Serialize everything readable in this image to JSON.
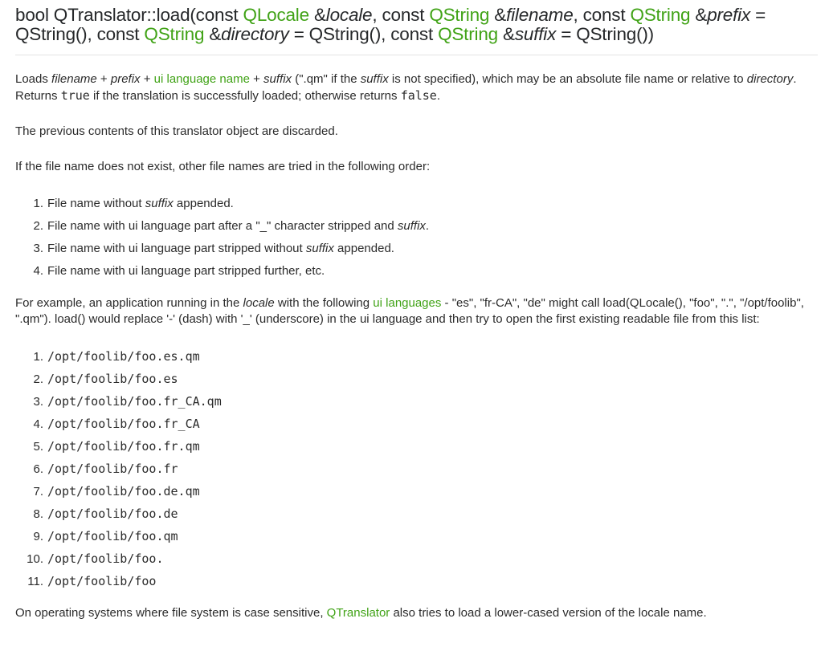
{
  "signature": {
    "t1": "bool QTranslator::load(const ",
    "qlocale": "QLocale",
    "t2": " &",
    "locale": "locale",
    "t3": ", const ",
    "qstring1": "QString",
    "t4": " &",
    "filename": "filename",
    "t5": ", const ",
    "qstring2": "QString",
    "t6": " &",
    "prefix": "prefix",
    "t7": " = QString(), const ",
    "qstring3": "QString",
    "t8": " &",
    "directory": "directory",
    "t9": " = QString(), const ",
    "qstring4": "QString",
    "t10": " &",
    "suffix": "suffix",
    "t11": " = QString())"
  },
  "para1": {
    "a": "Loads ",
    "filename": "filename",
    "b": " + ",
    "prefix": "prefix",
    "c": " + ",
    "link": "ui language name",
    "d": " + ",
    "suffix": "suffix",
    "e": " (\".qm\" if the ",
    "suffix2": "suffix",
    "f": " is not specified), which may be an absolute file name or relative to ",
    "directory": "directory",
    "g": ".",
    "h": "Returns ",
    "true": "true",
    "i": " if the translation is successfully loaded; otherwise returns ",
    "false": "false",
    "j": "."
  },
  "para2": "The previous contents of this translator object are discarded.",
  "para3": "If the file name does not exist, other file names are tried in the following order:",
  "order": [
    {
      "num": "1.",
      "a": "File name without ",
      "em": "suffix",
      "b": " appended."
    },
    {
      "num": "2.",
      "a": "File name with ui language part after a \"_\" character stripped and ",
      "em": "suffix",
      "b": "."
    },
    {
      "num": "3.",
      "a": "File name with ui language part stripped without ",
      "em": "suffix",
      "b": " appended."
    },
    {
      "num": "4.",
      "a": "File name with ui language part stripped further, etc.",
      "em": "",
      "b": ""
    }
  ],
  "para4": {
    "a": "For example, an application running in the ",
    "locale": "locale",
    "b": " with the following ",
    "link": "ui languages",
    "c": " - \"es\", \"fr-CA\", \"de\" might call load(QLocale(), \"foo\", \".\", \"/opt/foolib\",",
    "d": "\".qm\"). load() would replace '-' (dash) with '_' (underscore) in the ui language and then try to open the first existing readable file from this list:"
  },
  "files": [
    {
      "num": "1.",
      "path": "/opt/foolib/foo.es.qm"
    },
    {
      "num": "2.",
      "path": "/opt/foolib/foo.es"
    },
    {
      "num": "3.",
      "path": "/opt/foolib/foo.fr_CA.qm"
    },
    {
      "num": "4.",
      "path": "/opt/foolib/foo.fr_CA"
    },
    {
      "num": "5.",
      "path": "/opt/foolib/foo.fr.qm"
    },
    {
      "num": "6.",
      "path": "/opt/foolib/foo.fr"
    },
    {
      "num": "7.",
      "path": "/opt/foolib/foo.de.qm"
    },
    {
      "num": "8.",
      "path": "/opt/foolib/foo.de"
    },
    {
      "num": "9.",
      "path": "/opt/foolib/foo.qm"
    },
    {
      "num": "10.",
      "path": "/opt/foolib/foo."
    },
    {
      "num": "11.",
      "path": "/opt/foolib/foo"
    }
  ],
  "para5": {
    "a": "On operating systems where file system is case sensitive, ",
    "link": "QTranslator",
    "b": " also tries to load a lower-cased version of the locale name."
  },
  "colors": {
    "link": "#41a317",
    "text": "#2b2b2b",
    "rule": "#e3e3e3"
  }
}
